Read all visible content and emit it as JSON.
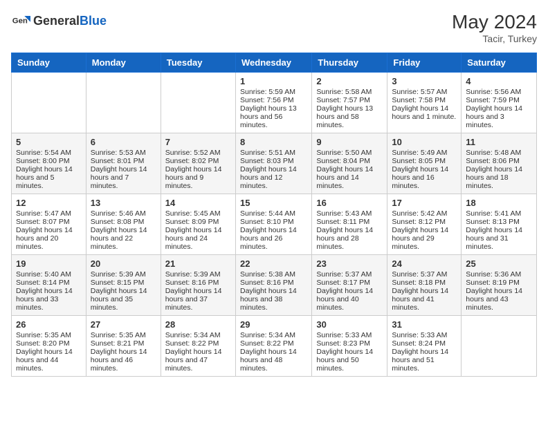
{
  "header": {
    "logo_general": "General",
    "logo_blue": "Blue",
    "month_year": "May 2024",
    "location": "Tacir, Turkey"
  },
  "days_of_week": [
    "Sunday",
    "Monday",
    "Tuesday",
    "Wednesday",
    "Thursday",
    "Friday",
    "Saturday"
  ],
  "weeks": [
    [
      {
        "day": "",
        "info": ""
      },
      {
        "day": "",
        "info": ""
      },
      {
        "day": "",
        "info": ""
      },
      {
        "day": "1",
        "sunrise": "5:59 AM",
        "sunset": "7:56 PM",
        "daylight": "13 hours and 56 minutes."
      },
      {
        "day": "2",
        "sunrise": "5:58 AM",
        "sunset": "7:57 PM",
        "daylight": "13 hours and 58 minutes."
      },
      {
        "day": "3",
        "sunrise": "5:57 AM",
        "sunset": "7:58 PM",
        "daylight": "14 hours and 1 minute."
      },
      {
        "day": "4",
        "sunrise": "5:56 AM",
        "sunset": "7:59 PM",
        "daylight": "14 hours and 3 minutes."
      }
    ],
    [
      {
        "day": "5",
        "sunrise": "5:54 AM",
        "sunset": "8:00 PM",
        "daylight": "14 hours and 5 minutes."
      },
      {
        "day": "6",
        "sunrise": "5:53 AM",
        "sunset": "8:01 PM",
        "daylight": "14 hours and 7 minutes."
      },
      {
        "day": "7",
        "sunrise": "5:52 AM",
        "sunset": "8:02 PM",
        "daylight": "14 hours and 9 minutes."
      },
      {
        "day": "8",
        "sunrise": "5:51 AM",
        "sunset": "8:03 PM",
        "daylight": "14 hours and 12 minutes."
      },
      {
        "day": "9",
        "sunrise": "5:50 AM",
        "sunset": "8:04 PM",
        "daylight": "14 hours and 14 minutes."
      },
      {
        "day": "10",
        "sunrise": "5:49 AM",
        "sunset": "8:05 PM",
        "daylight": "14 hours and 16 minutes."
      },
      {
        "day": "11",
        "sunrise": "5:48 AM",
        "sunset": "8:06 PM",
        "daylight": "14 hours and 18 minutes."
      }
    ],
    [
      {
        "day": "12",
        "sunrise": "5:47 AM",
        "sunset": "8:07 PM",
        "daylight": "14 hours and 20 minutes."
      },
      {
        "day": "13",
        "sunrise": "5:46 AM",
        "sunset": "8:08 PM",
        "daylight": "14 hours and 22 minutes."
      },
      {
        "day": "14",
        "sunrise": "5:45 AM",
        "sunset": "8:09 PM",
        "daylight": "14 hours and 24 minutes."
      },
      {
        "day": "15",
        "sunrise": "5:44 AM",
        "sunset": "8:10 PM",
        "daylight": "14 hours and 26 minutes."
      },
      {
        "day": "16",
        "sunrise": "5:43 AM",
        "sunset": "8:11 PM",
        "daylight": "14 hours and 28 minutes."
      },
      {
        "day": "17",
        "sunrise": "5:42 AM",
        "sunset": "8:12 PM",
        "daylight": "14 hours and 29 minutes."
      },
      {
        "day": "18",
        "sunrise": "5:41 AM",
        "sunset": "8:13 PM",
        "daylight": "14 hours and 31 minutes."
      }
    ],
    [
      {
        "day": "19",
        "sunrise": "5:40 AM",
        "sunset": "8:14 PM",
        "daylight": "14 hours and 33 minutes."
      },
      {
        "day": "20",
        "sunrise": "5:39 AM",
        "sunset": "8:15 PM",
        "daylight": "14 hours and 35 minutes."
      },
      {
        "day": "21",
        "sunrise": "5:39 AM",
        "sunset": "8:16 PM",
        "daylight": "14 hours and 37 minutes."
      },
      {
        "day": "22",
        "sunrise": "5:38 AM",
        "sunset": "8:16 PM",
        "daylight": "14 hours and 38 minutes."
      },
      {
        "day": "23",
        "sunrise": "5:37 AM",
        "sunset": "8:17 PM",
        "daylight": "14 hours and 40 minutes."
      },
      {
        "day": "24",
        "sunrise": "5:37 AM",
        "sunset": "8:18 PM",
        "daylight": "14 hours and 41 minutes."
      },
      {
        "day": "25",
        "sunrise": "5:36 AM",
        "sunset": "8:19 PM",
        "daylight": "14 hours and 43 minutes."
      }
    ],
    [
      {
        "day": "26",
        "sunrise": "5:35 AM",
        "sunset": "8:20 PM",
        "daylight": "14 hours and 44 minutes."
      },
      {
        "day": "27",
        "sunrise": "5:35 AM",
        "sunset": "8:21 PM",
        "daylight": "14 hours and 46 minutes."
      },
      {
        "day": "28",
        "sunrise": "5:34 AM",
        "sunset": "8:22 PM",
        "daylight": "14 hours and 47 minutes."
      },
      {
        "day": "29",
        "sunrise": "5:34 AM",
        "sunset": "8:22 PM",
        "daylight": "14 hours and 48 minutes."
      },
      {
        "day": "30",
        "sunrise": "5:33 AM",
        "sunset": "8:23 PM",
        "daylight": "14 hours and 50 minutes."
      },
      {
        "day": "31",
        "sunrise": "5:33 AM",
        "sunset": "8:24 PM",
        "daylight": "14 hours and 51 minutes."
      },
      {
        "day": "",
        "info": ""
      }
    ]
  ],
  "labels": {
    "sunrise": "Sunrise:",
    "sunset": "Sunset:",
    "daylight": "Daylight hours"
  }
}
